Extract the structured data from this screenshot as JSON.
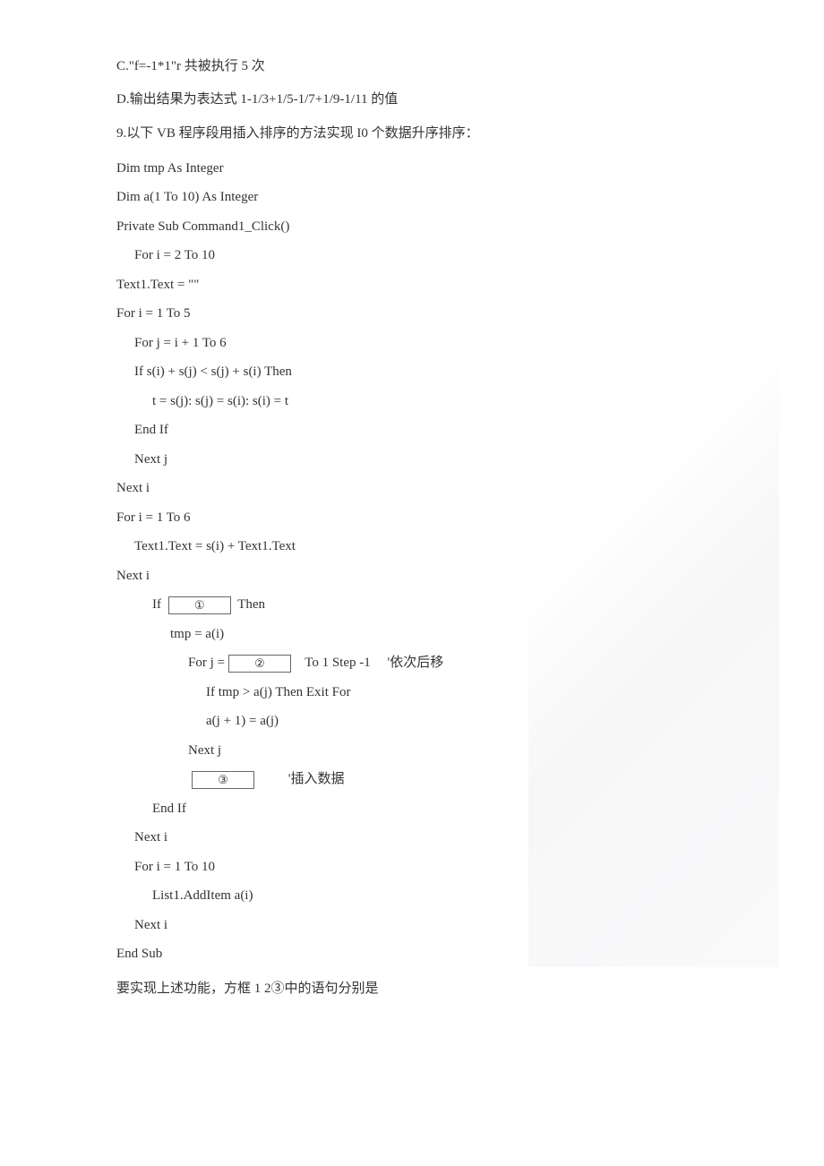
{
  "options": {
    "c": "C.\"f=-1*1\"r 共被执行 5 次",
    "d": "D.输出结果为表达式 1-1/3+1/5-1/7+1/9-1/11 的值"
  },
  "question": "9.以下 VB 程序段用插入排序的方法实现 I0 个数据升序排序：",
  "code": {
    "l1": "Dim tmp As Integer",
    "l2": "Dim a(1 To 10) As Integer",
    "l3": "Private Sub Command1_Click()",
    "l4": "For i = 2 To 10",
    "l5": "Text1.Text = \"\"",
    "l6": "For i = 1 To 5",
    "l7": "For j = i + 1 To 6",
    "l8": "If s(i) + s(j) < s(j) + s(i) Then",
    "l9": "t = s(j): s(j) = s(i): s(i) = t",
    "l10": "End If",
    "l11": "Next j",
    "l12": "Next i",
    "l13": "For i = 1 To 6",
    "l14": "Text1.Text = s(i) + Text1.Text",
    "l15": "Next i",
    "l16a": "If",
    "l16b": "①",
    "l16c": "Then",
    "l17": "tmp = a(i)",
    "l18a": "For j =",
    "l18b": "②",
    "l18c": "To 1 Step -1",
    "l18d": "'依次后移",
    "l19": "If tmp > a(j) Then Exit For",
    "l20": "a(j + 1) = a(j)",
    "l21": "Next j",
    "l22a": "③",
    "l22b": "'插入数据",
    "l23": "End If",
    "l24": "Next i",
    "l25": "For i = 1 To 10",
    "l26": "List1.AddItem a(i)",
    "l27": "Next i",
    "l28": "End Sub"
  },
  "closing": "要实现上述功能，方框 1 2③中的语句分别是"
}
